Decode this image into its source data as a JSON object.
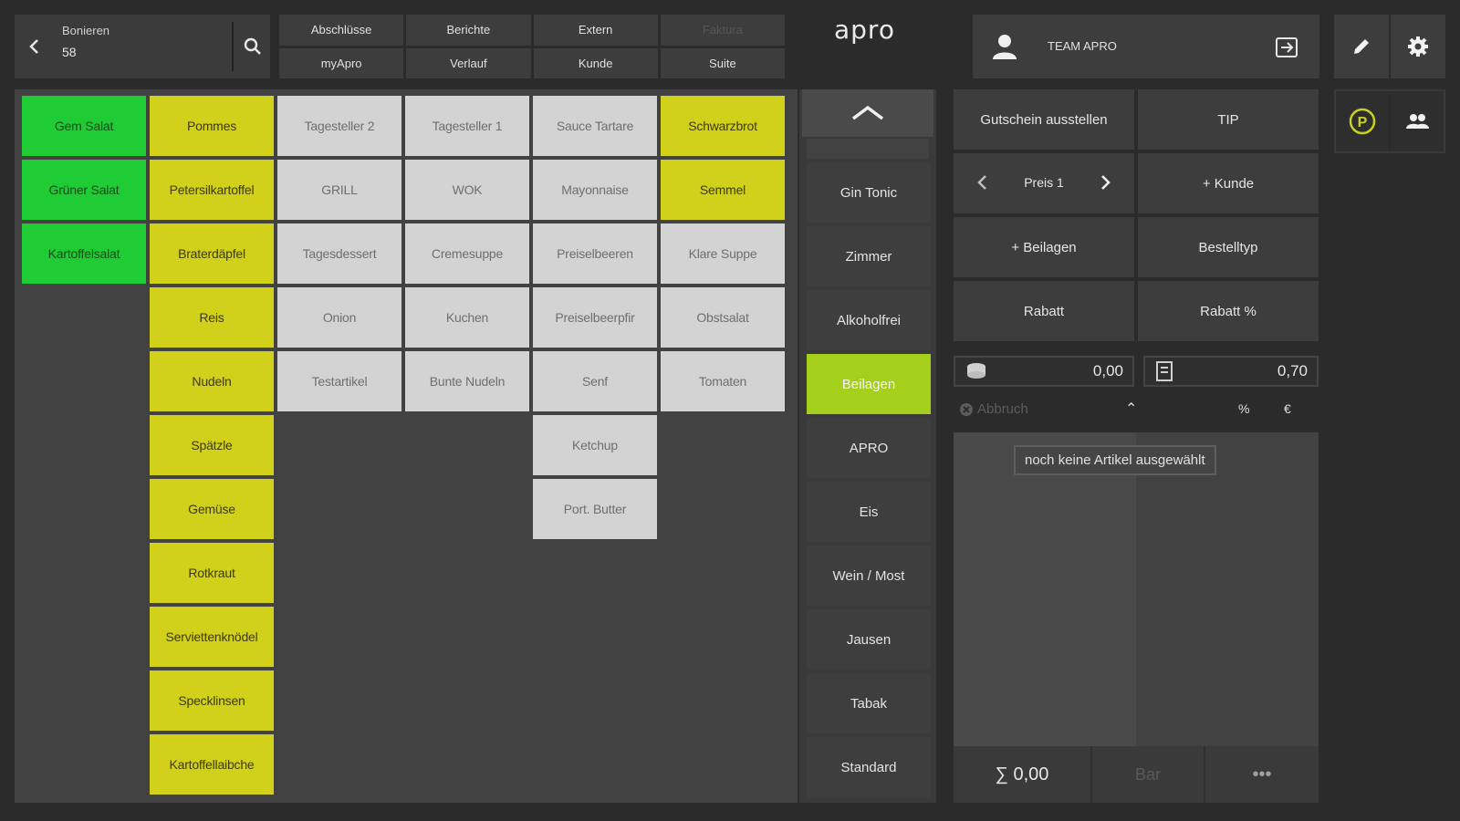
{
  "header": {
    "title_label": "Bonieren",
    "title_number": "58",
    "logo_text": "apro",
    "user_name": "TEAM APRO"
  },
  "nav": [
    {
      "label": "Abschlüsse",
      "disabled": false
    },
    {
      "label": "Berichte",
      "disabled": false
    },
    {
      "label": "Extern",
      "disabled": false
    },
    {
      "label": "Faktura",
      "disabled": true
    },
    {
      "label": "myApro",
      "disabled": false
    },
    {
      "label": "Verlauf",
      "disabled": false
    },
    {
      "label": "Kunde",
      "disabled": false
    },
    {
      "label": "Suite",
      "disabled": false
    }
  ],
  "products": {
    "green": [
      "Gem Salat",
      "Grüner Salat",
      "Kartoffelsalat"
    ],
    "yellow": [
      "Pommes",
      "Petersilkartoffel",
      "Braterdäpfel",
      "Reis",
      "Nudeln",
      "Spätzle",
      "Gemüse",
      "Rotkraut",
      "Serviettenknödel",
      "Specklinsen",
      "Kartoffellaibche"
    ],
    "gray_rows": [
      [
        "Tagesteller 2",
        "Tagesteller 1",
        "Sauce Tartare",
        "Schwarzbrot"
      ],
      [
        "GRILL",
        "WOK",
        "Mayonnaise",
        "Semmel"
      ],
      [
        "Tagesdessert",
        "Cremesuppe",
        "Preiselbeeren",
        "Klare Suppe"
      ],
      [
        "Onion",
        "Kuchen",
        "Preiselbeerpfir",
        "Obstsalat"
      ],
      [
        "Testartikel",
        "Bunte Nudeln",
        "Senf",
        "Tomaten"
      ]
    ],
    "gray_extra": [
      "Ketchup",
      "Port. Butter"
    ]
  },
  "categories": [
    "Gin Tonic",
    "Zimmer",
    "Alkoholfrei",
    "Beilagen",
    "APRO",
    "Eis",
    "Wein / Most",
    "Jausen",
    "Tabak",
    "Standard"
  ],
  "active_category": "Beilagen",
  "functions": {
    "voucher": "Gutschein ausstellen",
    "tip": "TIP",
    "price_label": "Preis 1",
    "customer": "+ Kunde",
    "sides": "+ Beilagen",
    "order_type": "Bestelltyp",
    "discount": "Rabatt",
    "discount_pct": "Rabatt %"
  },
  "amounts": {
    "left_value": "0,00",
    "right_value": "0,70"
  },
  "controls": {
    "abort": "Abbruch",
    "percent": "%",
    "euro": "€"
  },
  "order": {
    "empty_message": "noch keine Artikel ausgewählt"
  },
  "footer": {
    "total": "∑ 0,00",
    "cash": "Bar",
    "more": "•••"
  },
  "colors": {
    "green": "#1fcc35",
    "yellow": "#d1d01a",
    "active_category": "#a4cf1a",
    "accent_parking": "#c8d21e"
  },
  "icons": [
    "chevron-left-icon",
    "search-icon",
    "user-icon",
    "logout-icon",
    "pencil-icon",
    "gear-icon",
    "parking-icon",
    "people-icon",
    "chevron-up-icon",
    "chevron-right-icon",
    "coins-icon",
    "receipt-icon",
    "close-circle-icon"
  ]
}
